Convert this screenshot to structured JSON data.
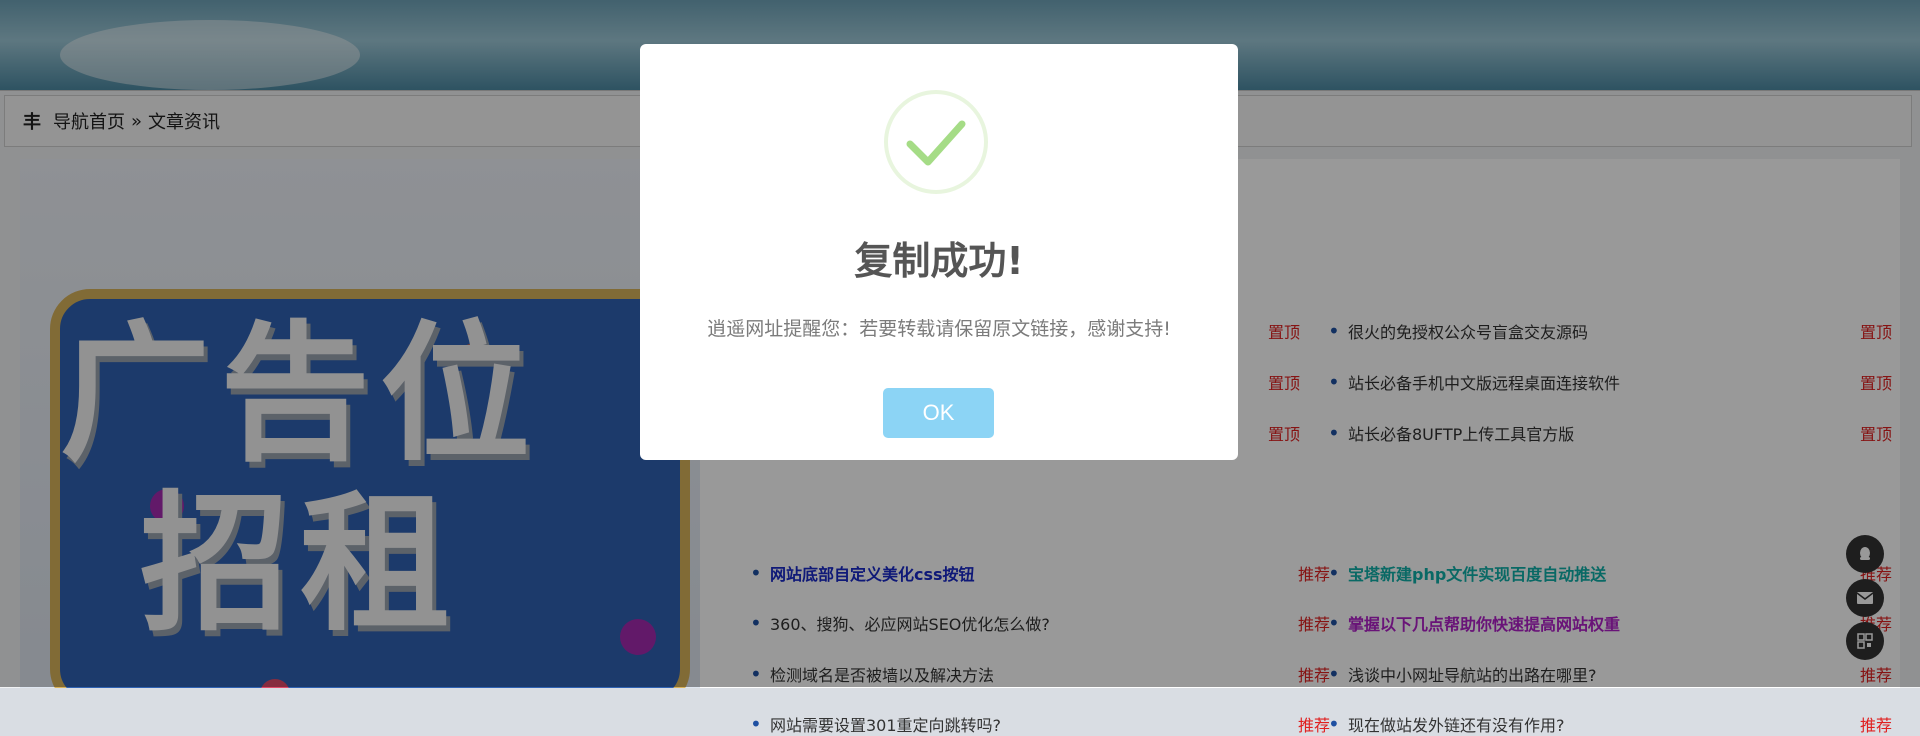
{
  "breadcrumb": {
    "home": "导航首页",
    "separator": "»",
    "current": "文章资讯"
  },
  "ad": {
    "line1": "广告位",
    "line2": "招租"
  },
  "top_list": {
    "left_tags": [
      "置顶",
      "置顶",
      "置顶"
    ],
    "right_items": [
      {
        "title": "很火的免授权公众号盲盒交友源码",
        "tag": "置顶"
      },
      {
        "title": "站长必备手机中文版远程桌面连接软件",
        "tag": "置顶"
      },
      {
        "title": "站长必备8UFTP上传工具官方版",
        "tag": "置顶"
      }
    ]
  },
  "rec_list": {
    "left_items": [
      {
        "title": "网站底部自定义美化css按钮",
        "tag": "推荐",
        "style": "t-blue"
      },
      {
        "title": "360、搜狗、必应网站SEO优化怎么做?",
        "tag": "推荐",
        "style": ""
      },
      {
        "title": "检测域名是否被墙以及解决方法",
        "tag": "推荐",
        "style": ""
      },
      {
        "title": "网站需要设置301重定向跳转吗?",
        "tag": "推荐",
        "style": ""
      }
    ],
    "right_items": [
      {
        "title": "宝塔新建php文件实现百度自动推送",
        "tag": "推荐",
        "style": "t-teal"
      },
      {
        "title": "掌握以下几点帮助你快速提高网站权重",
        "tag": "推荐",
        "style": "t-purple"
      },
      {
        "title": "浅谈中小网址导航站的出路在哪里?",
        "tag": "推荐",
        "style": ""
      },
      {
        "title": "现在做站发外链还有没有作用?",
        "tag": "推荐",
        "style": ""
      }
    ]
  },
  "float_icons": [
    "qq-icon",
    "mail-icon",
    "qrcode-icon"
  ],
  "modal": {
    "title": "复制成功!",
    "text": "逍遥网址提醒您：若要转载请保留原文链接，感谢支持!",
    "ok_label": "OK",
    "check_color": "#a5dc86",
    "button_color": "#8cd4f5"
  }
}
